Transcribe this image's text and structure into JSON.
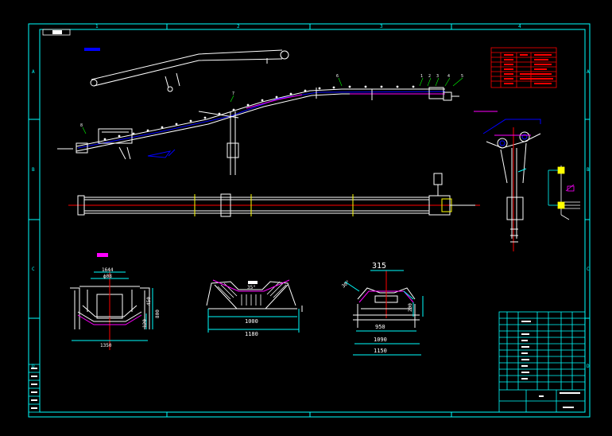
{
  "drawing": {
    "background": "#000000",
    "frame_color": "#00ffff",
    "line_color": "#ffffff",
    "accent_red": "#ff0000",
    "accent_magenta": "#ff00ff",
    "accent_yellow": "#ffff00",
    "accent_blue": "#0000ff"
  },
  "grid_refs": {
    "top": [
      "1",
      "2",
      "3",
      "4"
    ],
    "left": [
      "A",
      "B",
      "C",
      "D"
    ],
    "right": [
      "A",
      "B",
      "C",
      "D"
    ]
  },
  "views": {
    "idler_front": {
      "dimensions": [
        "1644",
        "ф08",
        "1350",
        "450",
        "800",
        "120"
      ]
    },
    "idler_trough": {
      "dimensions": [
        "35°",
        "1000",
        "1180"
      ]
    },
    "idler_return": {
      "dimensions": [
        "315",
        "30°",
        "200",
        "950",
        "1090",
        "1150"
      ]
    },
    "plan_view": {
      "balloon_numbers": [
        "1",
        "2",
        "3",
        "4",
        "5",
        "6",
        "7",
        "8"
      ]
    }
  }
}
